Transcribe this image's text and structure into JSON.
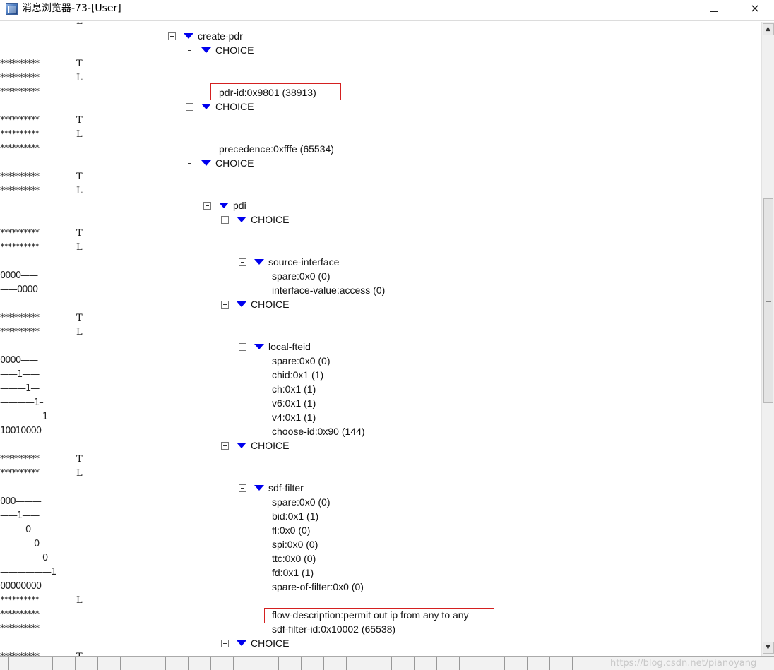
{
  "window": {
    "title": "消息浏览器-73-[User]",
    "icon": "message-browser-app-icon",
    "controls": {
      "minimize": "minimize",
      "maximize": "maximize",
      "close": "×"
    }
  },
  "left_columns": {
    "row_top_partial": {
      "bits": "**********",
      "tag": "L"
    },
    "rows": [
      {
        "bits": "**********",
        "tag": "T"
      },
      {
        "bits": "**********",
        "tag": "L"
      },
      {
        "bits": "**********",
        "tag": ""
      },
      {
        "bits": "**********",
        "tag": "T"
      },
      {
        "bits": "**********",
        "tag": "L"
      },
      {
        "bits": "**********",
        "tag": ""
      },
      {
        "bits": "**********",
        "tag": "T"
      },
      {
        "bits": "**********",
        "tag": "L"
      },
      {
        "bits": "**********",
        "tag": "T"
      },
      {
        "bits": "**********",
        "tag": "L"
      },
      {
        "bits": "0000——",
        "tag": ""
      },
      {
        "bits": "——0000",
        "tag": ""
      },
      {
        "bits": "**********",
        "tag": "T"
      },
      {
        "bits": "**********",
        "tag": "L"
      },
      {
        "bits": "0000——",
        "tag": ""
      },
      {
        "bits": "——1——",
        "tag": ""
      },
      {
        "bits": "———1—",
        "tag": ""
      },
      {
        "bits": "————1–",
        "tag": ""
      },
      {
        "bits": "—————1",
        "tag": ""
      },
      {
        "bits": "10010000",
        "tag": ""
      },
      {
        "bits": "**********",
        "tag": "T"
      },
      {
        "bits": "**********",
        "tag": "L"
      },
      {
        "bits": "000———",
        "tag": ""
      },
      {
        "bits": "——1——",
        "tag": ""
      },
      {
        "bits": "———0——",
        "tag": ""
      },
      {
        "bits": "————0—",
        "tag": ""
      },
      {
        "bits": "—————0–",
        "tag": ""
      },
      {
        "bits": "——————1",
        "tag": ""
      },
      {
        "bits": "00000000",
        "tag": ""
      },
      {
        "bits": "**********",
        "tag": "L"
      },
      {
        "bits": "**********",
        "tag": ""
      },
      {
        "bits": "**********",
        "tag": ""
      },
      {
        "bits": "**********",
        "tag": "T"
      }
    ]
  },
  "tree": {
    "create_pdr": "create-pdr",
    "choice_1": "CHOICE",
    "pdr_id": "pdr-id:0x9801 (38913)",
    "choice_2": "CHOICE",
    "precedence": "precedence:0xfffe (65534)",
    "choice_3": "CHOICE",
    "pdi": "pdi",
    "choice_4": "CHOICE",
    "source_interface": "source-interface",
    "si_spare": "spare:0x0 (0)",
    "si_interface_value": "interface-value:access (0)",
    "choice_5": "CHOICE",
    "local_fteid": "local-fteid",
    "lf_spare": "spare:0x0 (0)",
    "lf_chid": "chid:0x1 (1)",
    "lf_ch": "ch:0x1 (1)",
    "lf_v6": "v6:0x1 (1)",
    "lf_v4": "v4:0x1 (1)",
    "lf_choose_id": "choose-id:0x90 (144)",
    "choice_6": "CHOICE",
    "sdf_filter": "sdf-filter",
    "sf_spare": "spare:0x0 (0)",
    "sf_bid": "bid:0x1 (1)",
    "sf_fl": "fl:0x0 (0)",
    "sf_spi": "spi:0x0 (0)",
    "sf_ttc": "ttc:0x0 (0)",
    "sf_fd": "fd:0x1 (1)",
    "sf_spare_of_filter": "spare-of-filter:0x0 (0)",
    "sf_flow_description": "flow-description:permit out ip from any to any",
    "sf_sdf_filter_id": "sdf-filter-id:0x10002 (65538)",
    "choice_7": "CHOICE"
  },
  "scrollbar": {
    "up_arrow": "▲",
    "down_arrow": "▼",
    "thumb_grip": "grip-icon"
  },
  "watermark": "https://blog.csdn.net/pianoyang",
  "colors": {
    "expand_triangle": "#0000ee",
    "highlight_box": "#d42020"
  }
}
